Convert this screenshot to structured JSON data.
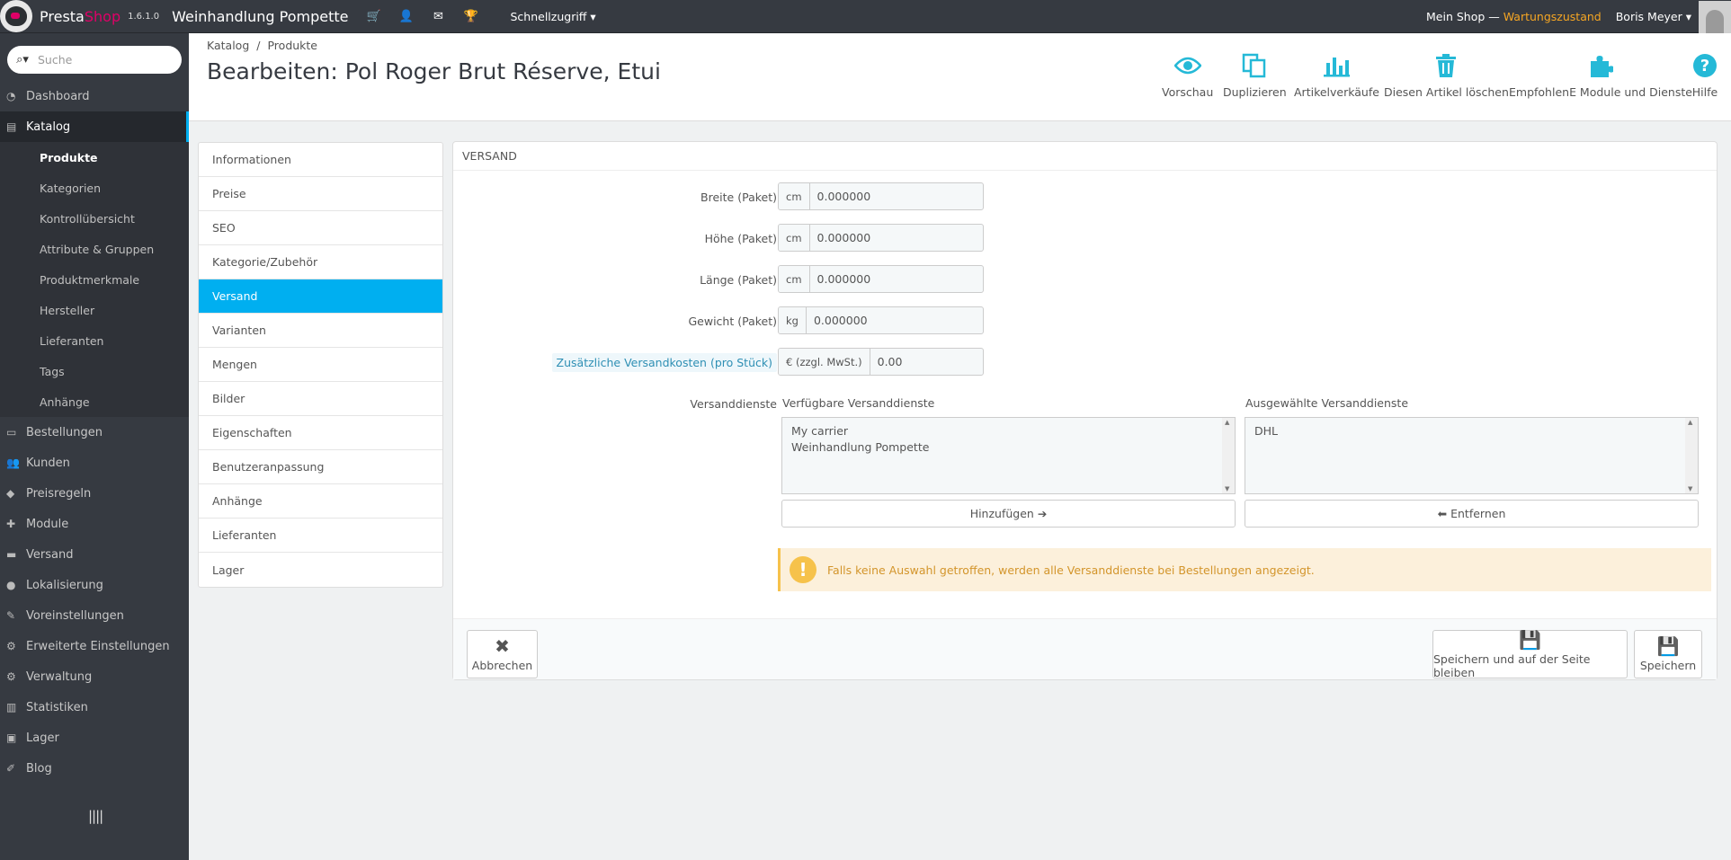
{
  "topbar": {
    "brand_a": "Presta",
    "brand_b": "Shop",
    "version": "1.6.1.0",
    "shop_name": "Weinhandlung Pompette",
    "quick_access": "Schnellzugriff",
    "my_shop": "Mein Shop — ",
    "maintenance": "Wartungszustand",
    "user": "Boris Meyer"
  },
  "sidebar": {
    "search_placeholder": "Suche",
    "items": [
      {
        "label": "Dashboard",
        "icon": "dashboard-icon"
      },
      {
        "label": "Katalog",
        "icon": "book-icon"
      },
      {
        "label": "Bestellungen",
        "icon": "credit-card-icon"
      },
      {
        "label": "Kunden",
        "icon": "users-icon"
      },
      {
        "label": "Preisregeln",
        "icon": "tag-icon"
      },
      {
        "label": "Module",
        "icon": "puzzle-icon"
      },
      {
        "label": "Versand",
        "icon": "truck-icon"
      },
      {
        "label": "Lokalisierung",
        "icon": "globe-icon"
      },
      {
        "label": "Voreinstellungen",
        "icon": "wrench-icon"
      },
      {
        "label": "Erweiterte Einstellungen",
        "icon": "cogs-icon"
      },
      {
        "label": "Verwaltung",
        "icon": "gear-icon"
      },
      {
        "label": "Statistiken",
        "icon": "bar-chart-icon"
      },
      {
        "label": "Lager",
        "icon": "archive-icon"
      },
      {
        "label": "Blog",
        "icon": "edit-icon"
      }
    ],
    "catalog_sub": [
      "Produkte",
      "Kategorien",
      "Kontrollübersicht",
      "Attribute & Gruppen",
      "Produktmerkmale",
      "Hersteller",
      "Lieferanten",
      "Tags",
      "Anhänge"
    ]
  },
  "header": {
    "breadcrumb": [
      "Katalog",
      "Produkte"
    ],
    "title": "Bearbeiten: Pol Roger Brut Réserve, Etui",
    "toolbar": {
      "preview": "Vorschau",
      "duplicate": "Duplizieren",
      "sales": "Artikelverkäufe",
      "delete": "Diesen Artikel löschen",
      "recommended": "EmpfohlenE Module und Dienste",
      "help": "Hilfe"
    }
  },
  "tabs": [
    "Informationen",
    "Preise",
    "SEO",
    "Kategorie/Zubehör",
    "Versand",
    "Varianten",
    "Mengen",
    "Bilder",
    "Eigenschaften",
    "Benutzeranpassung",
    "Anhänge",
    "Lieferanten",
    "Lager"
  ],
  "panel": {
    "heading": "Versand",
    "fields": {
      "width": {
        "label": "Breite (Paket)",
        "unit": "cm",
        "value": "0.000000"
      },
      "height": {
        "label": "Höhe (Paket)",
        "unit": "cm",
        "value": "0.000000"
      },
      "depth": {
        "label": "Länge (Paket)",
        "unit": "cm",
        "value": "0.000000"
      },
      "weight": {
        "label": "Gewicht (Paket)",
        "unit": "kg",
        "value": "0.000000"
      },
      "extra": {
        "label": "Zusätzliche Versandkosten (pro Stück)",
        "unit": "€ (zzgl. MwSt.)",
        "value": "0.00"
      }
    },
    "carriers": {
      "label": "Versanddienste",
      "available_label": "Verfügbare Versanddienste",
      "available": [
        "My carrier",
        "Weinhandlung Pompette"
      ],
      "selected_label": "Ausgewählte Versanddienste",
      "selected": [
        "DHL"
      ],
      "add_button": "Hinzufügen",
      "remove_button": "Entfernen"
    },
    "warning": "Falls keine Auswahl getroffen, werden alle Versanddienste bei Bestellungen angezeigt.",
    "footer": {
      "cancel": "Abbrechen",
      "save_stay": "Speichern und auf der Seite bleiben",
      "save": "Speichern"
    }
  }
}
